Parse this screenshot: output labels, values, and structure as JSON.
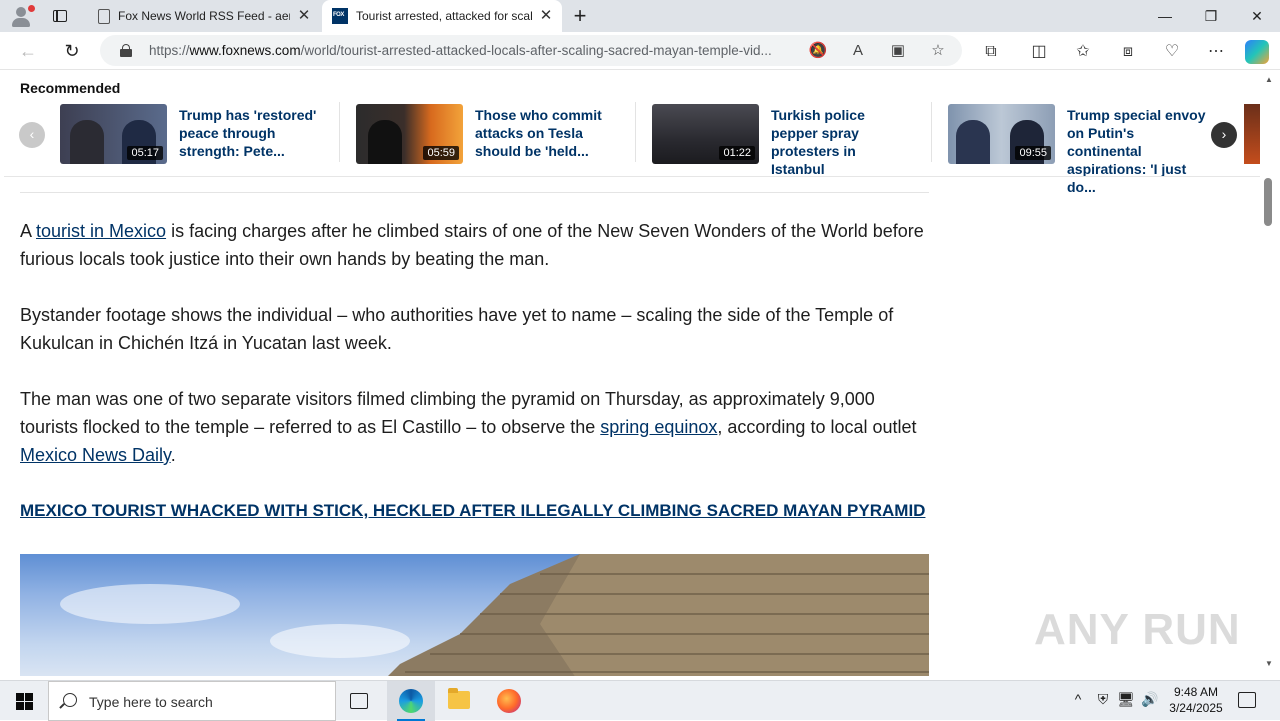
{
  "browser": {
    "tabs": [
      {
        "title": "Fox News World RSS Feed - aerop",
        "active": false
      },
      {
        "title": "Tourist arrested, attacked for scali",
        "active": true
      }
    ],
    "url_prefix": "https://",
    "url_host": "www.foxnews.com",
    "url_path": "/world/tourist-arrested-attacked-locals-after-scaling-sacred-mayan-temple-vid..."
  },
  "page": {
    "recommended_title": "Recommended",
    "recommended": [
      {
        "title": "Trump has 'restored' peace through strength: Pete...",
        "duration": "05:17"
      },
      {
        "title": "Those who commit attacks on Tesla should be 'held...",
        "duration": "05:59"
      },
      {
        "title": "Turkish police pepper spray protesters in Istanbul",
        "duration": "01:22"
      },
      {
        "title": "Trump special envoy on Putin's continental aspirations: 'I just do...",
        "duration": "09:55"
      }
    ],
    "p1": {
      "before": "A ",
      "link": "tourist in Mexico",
      "after": " is facing charges after he climbed stairs of one of the New Seven Wonders of the World before furious locals took justice into their own hands by beating the man."
    },
    "p2": "Bystander footage shows the individual – who authorities have yet to name – scaling the side of the Temple of Kukulcan in Chichén Itzá in Yucatan last week.",
    "p3": {
      "before": "The man was one of two separate visitors filmed climbing the pyramid on Thursday, as approximately 9,000 tourists flocked to the temple – referred to as El Castillo – to observe the ",
      "link1": "spring equinox",
      "middle": ", according to local outlet ",
      "link2": "Mexico News Daily",
      "after": "."
    },
    "headline": "MEXICO TOURIST WHACKED WITH STICK, HECKLED AFTER ILLEGALLY CLIMBING SACRED MAYAN PYRAMID",
    "watermark": "ANY RUN"
  },
  "taskbar": {
    "search_placeholder": "Type here to search",
    "time": "9:48 AM",
    "date": "3/24/2025"
  },
  "colors": {
    "link": "#003366",
    "accent": "#0078d4"
  }
}
